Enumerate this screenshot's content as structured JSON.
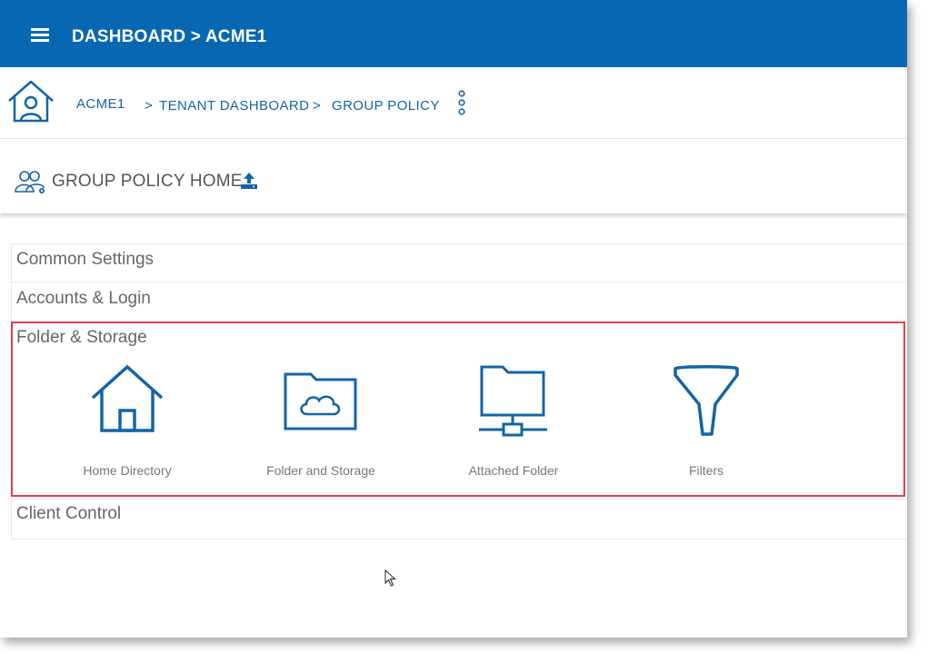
{
  "topbar": {
    "title": "DASHBOARD > ACME1"
  },
  "breadcrumb": {
    "items": [
      {
        "label": "ACME1"
      },
      {
        "label": "TENANT DASHBOARD"
      },
      {
        "label": "GROUP POLICY"
      }
    ],
    "separator": ">"
  },
  "section": {
    "title": "GROUP POLICY HOME"
  },
  "categories": [
    {
      "label": "Common Settings"
    },
    {
      "label": "Accounts & Login"
    },
    {
      "label": "Folder & Storage"
    },
    {
      "label": "Client Control"
    }
  ],
  "tiles": [
    {
      "label": "Home Directory",
      "icon": "house-icon"
    },
    {
      "label": "Folder and Storage",
      "icon": "cloud-folder-icon"
    },
    {
      "label": "Attached Folder",
      "icon": "network-folder-icon"
    },
    {
      "label": "Filters",
      "icon": "funnel-icon"
    }
  ],
  "colors": {
    "brand": "#0767b3",
    "link": "#1264a8",
    "highlight": "#e0434b"
  }
}
